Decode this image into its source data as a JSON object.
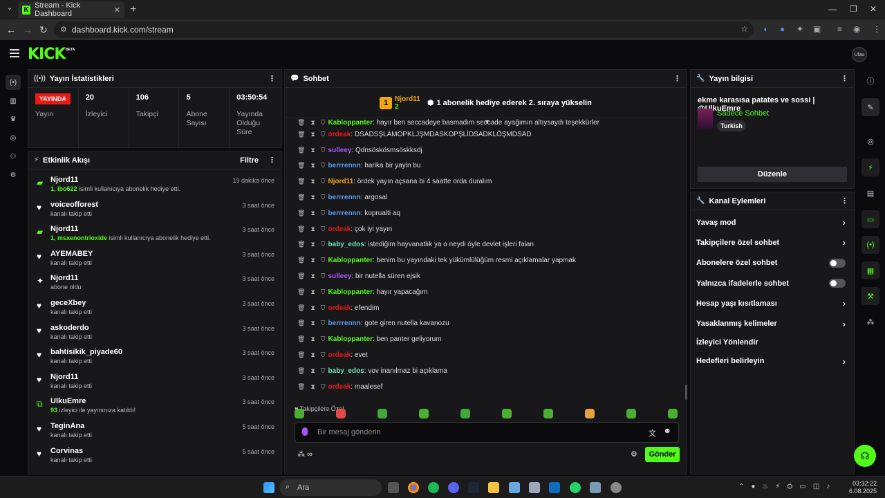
{
  "browser": {
    "tab_title": "Stream - Kick Dashboard",
    "url": "dashboard.kick.com/stream"
  },
  "header": {
    "logo": "KICK",
    "beta": "BETA",
    "avatar_text": "Ulau"
  },
  "stats_panel": {
    "title": "Yayın İstatistikleri",
    "live_badge": "YAYINDA",
    "live_label": "Yayın",
    "items": [
      {
        "value": "20",
        "label": "İzleyici"
      },
      {
        "value": "106",
        "label": "Takipçi"
      },
      {
        "value": "5",
        "label": "Abone Sayısı"
      },
      {
        "value": "03:50:54",
        "label": "Yayında Olduğu Süre"
      }
    ]
  },
  "activity": {
    "title": "Etkinlik Akışı",
    "filter": "Filtre",
    "items": [
      {
        "icon": "gift-icon",
        "name": "Njord11",
        "hl": "1, ibo622",
        "desc": " isimli kullanıcıya abonelik hediye etti.",
        "time": "19 dakika önce"
      },
      {
        "icon": "heart-icon",
        "name": "voiceofforest",
        "hl": "",
        "desc": "kanalı takip etti",
        "time": "3 saat önce"
      },
      {
        "icon": "gift-icon",
        "name": "Njord11",
        "hl": "1, msxenontrioxide",
        "desc": " isimli kullanıcıya abonelik hediye etti.",
        "time": "3 saat önce"
      },
      {
        "icon": "heart-icon",
        "name": "AYEMABEY",
        "hl": "",
        "desc": "kanalı takip etti",
        "time": "3 saat önce"
      },
      {
        "icon": "star-icon",
        "name": "Njord11",
        "hl": "",
        "desc": "abone oldu",
        "time": "3 saat önce"
      },
      {
        "icon": "heart-icon",
        "name": "geceXbey",
        "hl": "",
        "desc": "kanalı takip etti",
        "time": "3 saat önce"
      },
      {
        "icon": "heart-icon",
        "name": "askoderdo",
        "hl": "",
        "desc": "kanalı takip etti",
        "time": "3 saat önce"
      },
      {
        "icon": "heart-icon",
        "name": "bahtisikik_piyade60",
        "hl": "",
        "desc": "kanalı takip etti",
        "time": "3 saat önce"
      },
      {
        "icon": "heart-icon",
        "name": "Njord11",
        "hl": "",
        "desc": "kanalı takip etti",
        "time": "3 saat önce"
      },
      {
        "icon": "host-icon",
        "name": "UlkuEmre",
        "hl": "93",
        "desc": " izleyici ile yayınınıza katıldı!",
        "time": "3 saat önce"
      },
      {
        "icon": "heart-icon",
        "name": "TeginAna",
        "hl": "",
        "desc": "kanalı takip etti",
        "time": "5 saat önce"
      },
      {
        "icon": "heart-icon",
        "name": "Corvinas",
        "hl": "",
        "desc": "kanalı takip etti",
        "time": "5 saat önce"
      }
    ]
  },
  "chat": {
    "title": "Sohbet",
    "pinned": {
      "rank": "1",
      "name": "Njord11",
      "count": "2",
      "text": "1 abonelik hediye ederek 2. sıraya yükselin"
    },
    "messages": [
      {
        "user": "Kabloppanter",
        "color": "#53fc18",
        "text": ": hayır ben seccadeye basmadım seccade ayağımın altıysaydı teşekkürler"
      },
      {
        "user": "ordeak",
        "color": "#e91916",
        "text": ": DSADSŞLAMOPKLJŞMDASKOPŞLİDSADKLÖŞMDSAD"
      },
      {
        "user": "sulleey",
        "color": "#a855f7",
        "text": ": Qdnsöskösmsöskksdj"
      },
      {
        "user": "berrrennn",
        "color": "#5b9cf6",
        "text": ": harika bir yayin bu"
      },
      {
        "user": "Njord11",
        "color": "#f0a514",
        "text": ": ördek yayın açsana bi 4 saatte orda duralım"
      },
      {
        "user": "berrrennn",
        "color": "#5b9cf6",
        "text": ": argosal"
      },
      {
        "user": "berrrennn",
        "color": "#5b9cf6",
        "text": ": koprualti aq"
      },
      {
        "user": "ordeak",
        "color": "#e91916",
        "text": ": çok iyi yayın"
      },
      {
        "user": "baby_edos",
        "color": "#6ee7b7",
        "text": ": istediğim hayvanatlık ya o neydi öyle devlet işleri falan"
      },
      {
        "user": "Kabloppanter",
        "color": "#53fc18",
        "text": ": benim bu yayındaki tek yükümlülüğüm resmi açıklamalar yapmak"
      },
      {
        "user": "sulleey",
        "color": "#a855f7",
        "text": ": bir nutella süren ejsik"
      },
      {
        "user": "Kabloppanter",
        "color": "#53fc18",
        "text": ": hayır yapacağım"
      },
      {
        "user": "ordeak",
        "color": "#e91916",
        "text": ": efendim"
      },
      {
        "user": "berrrennn",
        "color": "#5b9cf6",
        "text": ": gote giren nutella kavanozu"
      },
      {
        "user": "Kabloppanter",
        "color": "#53fc18",
        "text": ": ben panter geliyorum"
      },
      {
        "user": "ordeak",
        "color": "#e91916",
        "text": ": evet"
      },
      {
        "user": "baby_edos",
        "color": "#6ee7b7",
        "text": ": vov inanılmaz bi açıklama"
      },
      {
        "user": "ordeak",
        "color": "#e91916",
        "text": ": maalesef"
      }
    ],
    "followers_only": "Takipçilere Özel",
    "placeholder": "Bir mesaj gönderin",
    "send": "Gönder"
  },
  "stream_info": {
    "title": "Yayın bilgisi",
    "stream_title": "ekme karasısa patates ve sossi | @UlkuEmre",
    "category": "Sadece Sohbet",
    "tag": "Turkish",
    "edit": "Düzenle"
  },
  "channel_actions": {
    "title": "Kanal Eylemleri",
    "items": [
      {
        "label": "Yavaş mod",
        "kind": "chevron"
      },
      {
        "label": "Takipçilere özel sohbet",
        "kind": "chevron"
      },
      {
        "label": "Abonelere özel sohbet",
        "kind": "toggle"
      },
      {
        "label": "Yalnızca ifadelerle sohbet",
        "kind": "toggle"
      },
      {
        "label": "Hesap yaşı kısıtlaması",
        "kind": "chevron"
      },
      {
        "label": "Yasaklanmış kelimeler",
        "kind": "chevron"
      },
      {
        "label": "İzleyici Yönlendir",
        "kind": "none"
      },
      {
        "label": "Hedefleri belirleyin",
        "kind": "chevron"
      }
    ]
  },
  "taskbar": {
    "search": "Ara",
    "time": "03:32:22",
    "date": "6.08.2025"
  }
}
